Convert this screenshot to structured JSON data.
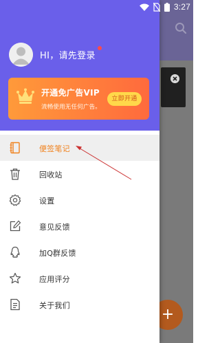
{
  "status_bar": {
    "time": "3:27",
    "wifi_icon": "wifi-icon",
    "sim_icon": "no-sim-icon",
    "battery_icon": "battery-icon"
  },
  "background": {
    "search_icon": "search-icon",
    "card_close_icon": "close-icon",
    "fab_label": "+"
  },
  "drawer": {
    "avatar_icon": "user-avatar-icon",
    "login_text": "HI，请先登录",
    "vip": {
      "title": "开通免广告VIP",
      "subtitle": "流畅使用无任何广告。",
      "button": "立即开通",
      "icon": "crown-icon"
    },
    "menu": [
      {
        "label": "便签笔记",
        "icon": "notebook-icon",
        "active": true
      },
      {
        "label": "回收站",
        "icon": "trash-icon"
      },
      {
        "label": "设置",
        "icon": "gear-icon"
      },
      {
        "label": "意见反馈",
        "icon": "edit-icon"
      },
      {
        "label": "加Q群反馈",
        "icon": "qq-icon"
      },
      {
        "label": "应用评分",
        "icon": "star-icon"
      },
      {
        "label": "关于我们",
        "icon": "document-icon"
      }
    ]
  },
  "colors": {
    "drawer_header": "#6a5fea",
    "accent_orange": "#f0821e",
    "vip_gradient_start": "#ff9a3a",
    "vip_gradient_end": "#ff6a3d",
    "vip_button": "#ffd84a",
    "annotation_arrow": "#cc3333"
  }
}
